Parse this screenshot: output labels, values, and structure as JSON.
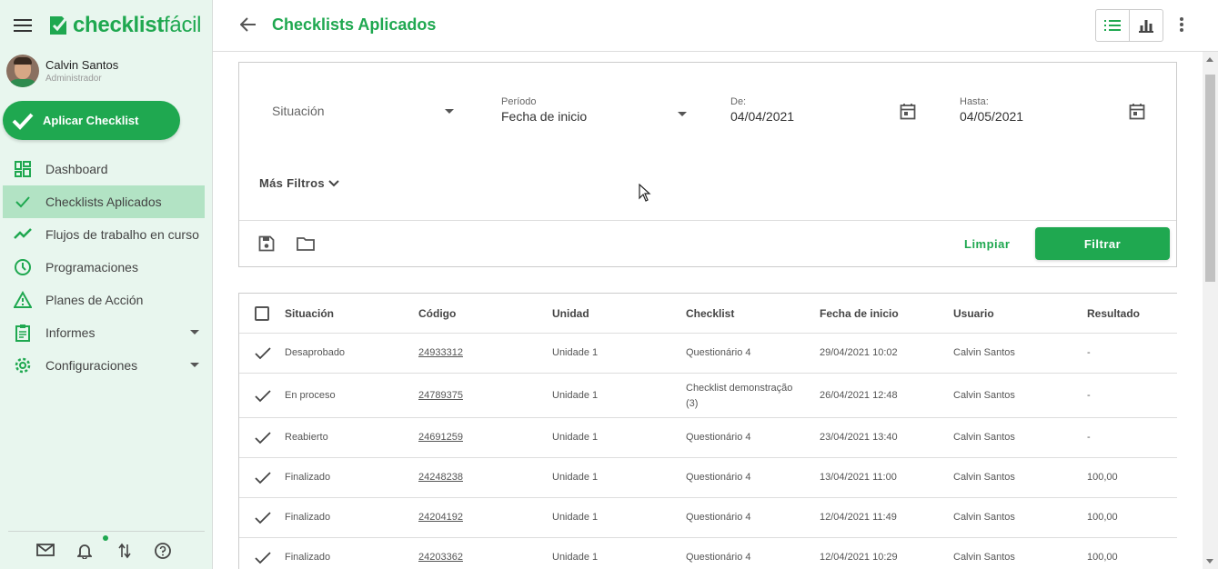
{
  "brand": {
    "name_bold": "checklist",
    "name_light": "fácil",
    "color": "#1fa850"
  },
  "user": {
    "name": "Calvin Santos",
    "role": "Administrador"
  },
  "apply_button": "Aplicar Checklist",
  "nav": [
    {
      "label": "Dashboard",
      "icon": "dashboard-icon",
      "active": false
    },
    {
      "label": "Checklists Aplicados",
      "icon": "check-icon",
      "active": true
    },
    {
      "label": "Flujos de trabalho en curso",
      "icon": "trending-icon",
      "active": false
    },
    {
      "label": "Programaciones",
      "icon": "clock-icon",
      "active": false
    },
    {
      "label": "Planes de Acción",
      "icon": "warning-icon",
      "active": false
    },
    {
      "label": "Informes",
      "icon": "clipboard-icon",
      "active": false
    },
    {
      "label": "Configuraciones",
      "icon": "gear-icon",
      "active": false
    }
  ],
  "header": {
    "title": "Checklists Aplicados"
  },
  "filters": {
    "situacion": {
      "placeholder": "Situación"
    },
    "periodo": {
      "label": "Período",
      "value": "Fecha de inicio"
    },
    "de": {
      "label": "De:",
      "value": "04/04/2021"
    },
    "hasta": {
      "label": "Hasta:",
      "value": "04/05/2021"
    },
    "more": "Más Filtros",
    "clear": "Limpiar",
    "filter": "Filtrar"
  },
  "table": {
    "columns": [
      "Situación",
      "Código",
      "Unidad",
      "Checklist",
      "Fecha de inicio",
      "Usuario",
      "Resultado"
    ],
    "rows": [
      {
        "situacion": "Desaprobado",
        "codigo": "24933312",
        "unidad": "Unidade 1",
        "checklist": "Questionário 4",
        "checklist2": "",
        "fecha": "29/04/2021 10:02",
        "usuario": "Calvin Santos",
        "resultado": "-"
      },
      {
        "situacion": "En proceso",
        "codigo": "24789375",
        "unidad": "Unidade 1",
        "checklist": "Checklist demonstração",
        "checklist2": "(3)",
        "fecha": "26/04/2021 12:48",
        "usuario": "Calvin Santos",
        "resultado": "-"
      },
      {
        "situacion": "Reabierto",
        "codigo": "24691259",
        "unidad": "Unidade 1",
        "checklist": "Questionário 4",
        "checklist2": "",
        "fecha": "23/04/2021 13:40",
        "usuario": "Calvin Santos",
        "resultado": "-"
      },
      {
        "situacion": "Finalizado",
        "codigo": "24248238",
        "unidad": "Unidade 1",
        "checklist": "Questionário 4",
        "checklist2": "",
        "fecha": "13/04/2021 11:00",
        "usuario": "Calvin Santos",
        "resultado": "100,00"
      },
      {
        "situacion": "Finalizado",
        "codigo": "24204192",
        "unidad": "Unidade 1",
        "checklist": "Questionário 4",
        "checklist2": "",
        "fecha": "12/04/2021 11:49",
        "usuario": "Calvin Santos",
        "resultado": "100,00"
      },
      {
        "situacion": "Finalizado",
        "codigo": "24203362",
        "unidad": "Unidade 1",
        "checklist": "Questionário 4",
        "checklist2": "",
        "fecha": "12/04/2021 10:29",
        "usuario": "Calvin Santos",
        "resultado": "100,00"
      }
    ]
  }
}
